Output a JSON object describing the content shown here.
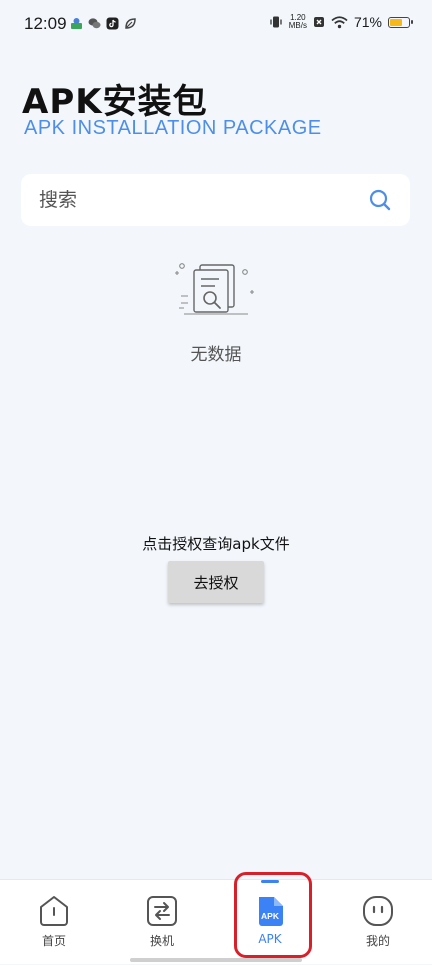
{
  "status_bar": {
    "time": "12:09",
    "net_speed_value": "1.20",
    "net_speed_unit": "MB/s",
    "battery_percent": "71%",
    "battery_level": 0.71,
    "battery_color": "#f6b919"
  },
  "header": {
    "title": "APK安装包",
    "subtitle": "APK INSTALLATION PACKAGE"
  },
  "search": {
    "placeholder": "搜索",
    "value": ""
  },
  "empty_state": {
    "text": "无数据",
    "icon": "document-search-icon"
  },
  "auth": {
    "prompt": "点击授权查询apk文件",
    "button_label": "去授权"
  },
  "bottom_nav": {
    "items": [
      {
        "label": "首页",
        "icon": "home-icon",
        "active": false
      },
      {
        "label": "换机",
        "icon": "transfer-icon",
        "active": false
      },
      {
        "label": "APK",
        "icon": "apk-file-icon",
        "active": true
      },
      {
        "label": "我的",
        "icon": "profile-face-icon",
        "active": false
      }
    ],
    "active_color": "#3b82f6",
    "highlight_color": "#d9202a"
  },
  "colors": {
    "background": "#f3f7fc",
    "accent": "#4d8fe8"
  }
}
